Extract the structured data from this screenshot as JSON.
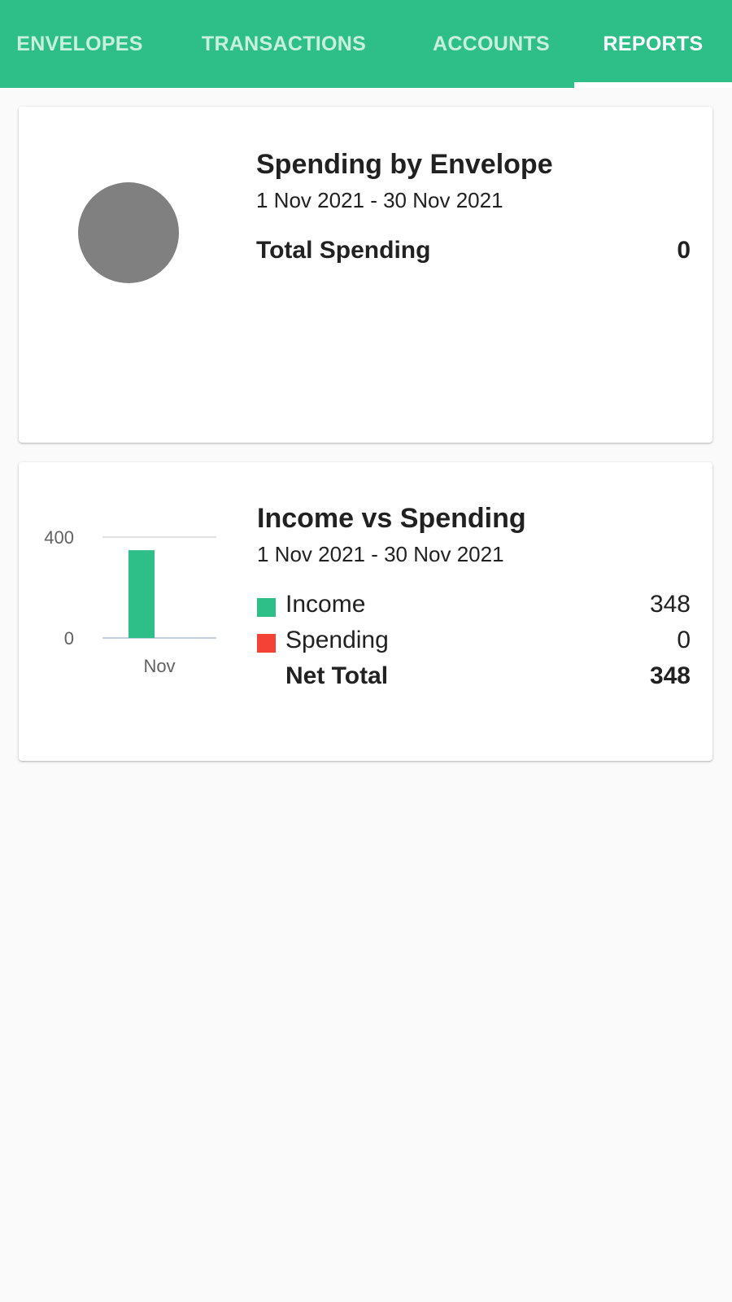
{
  "tabs": [
    {
      "label": "ENVELOPES",
      "active": false
    },
    {
      "label": "TRANSACTIONS",
      "active": false
    },
    {
      "label": "ACCOUNTS",
      "active": false
    },
    {
      "label": "REPORTS",
      "active": true
    }
  ],
  "colors": {
    "primary": "#2ebf88",
    "tab_inactive": "#c8f0dc",
    "income": "#2ebf88",
    "spending": "#f44336",
    "pie_empty": "#808080"
  },
  "spending_card": {
    "title": "Spending by Envelope",
    "date_range": "1 Nov 2021 - 30 Nov 2021",
    "total_label": "Total Spending",
    "total_value": "0"
  },
  "income_card": {
    "title": "Income vs Spending",
    "date_range": "1 Nov 2021 - 30 Nov 2021",
    "rows": [
      {
        "label": "Income",
        "value": "348",
        "swatch": "income"
      },
      {
        "label": "Spending",
        "value": "0",
        "swatch": "spending"
      },
      {
        "label": "Net Total",
        "value": "348",
        "swatch": null
      }
    ]
  },
  "chart_data": [
    {
      "type": "pie",
      "categories": [],
      "values": [],
      "note_color": "#808080"
    },
    {
      "type": "bar",
      "categories": [
        "Nov"
      ],
      "series": [
        {
          "name": "Income",
          "values": [
            348
          ]
        },
        {
          "name": "Spending",
          "values": [
            0
          ]
        }
      ],
      "yticks": [
        0,
        400
      ],
      "ylim": [
        0,
        400
      ],
      "grid": true
    }
  ]
}
